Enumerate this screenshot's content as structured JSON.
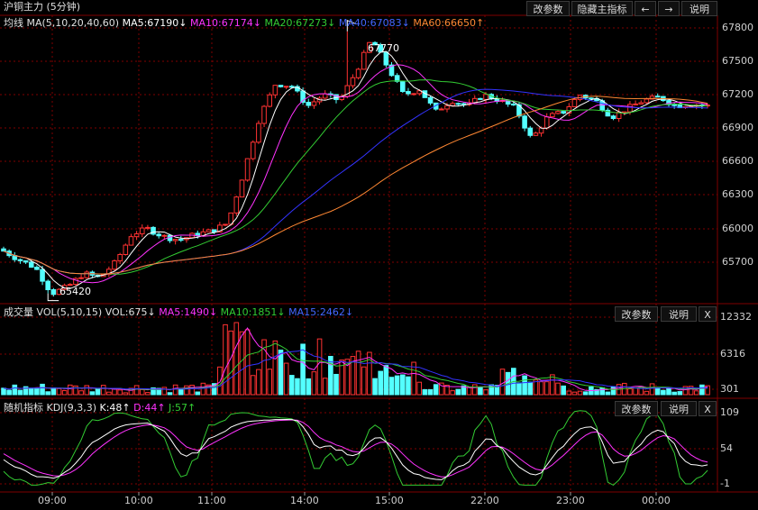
{
  "main_panel": {
    "title": "沪铜主力 (5分钟)",
    "indicator_prefix": "均线",
    "ma_header": "MA(5,10,20,40,60)",
    "ma5": "MA5:67190↓",
    "ma10": "MA10:67174↓",
    "ma20": "MA20:67273↓",
    "ma40": "MA40:67083↓",
    "ma60": "MA60:66650↑",
    "high_marker": "67770",
    "low_marker": "65420",
    "buttons": {
      "params": "改参数",
      "hide": "隐藏主指标",
      "left": "←",
      "right": "→",
      "help": "说明"
    },
    "y_ticks": [
      "67800",
      "67500",
      "67200",
      "66900",
      "66600",
      "66300",
      "66000",
      "65700"
    ]
  },
  "volume_panel": {
    "label": "成交量",
    "vol_header": "VOL(5,10,15)",
    "vol": "VOL:675↓",
    "ma5": "MA5:1490↓",
    "ma10": "MA10:1851↓",
    "ma15": "MA15:2462↓",
    "buttons": {
      "params": "改参数",
      "help": "说明",
      "close": "X"
    },
    "y_ticks": [
      "12332",
      "6316",
      "301"
    ]
  },
  "kdj_panel": {
    "label": "随机指标",
    "kdj_header": "KDJ(9,3,3)",
    "k": "K:48↑",
    "d": "D:44↑",
    "j": "J:57↑",
    "buttons": {
      "params": "改参数",
      "help": "说明",
      "close": "X"
    },
    "y_ticks": [
      "109",
      "54",
      "-1"
    ]
  },
  "x_axis": [
    "09:00",
    "10:00",
    "11:00",
    "14:00",
    "15:00",
    "22:00",
    "23:00",
    "00:00"
  ],
  "colors": {
    "up": "#ff3232",
    "down": "#54ffff",
    "ma5": "#ffffff",
    "ma10": "#ff33ff",
    "ma20": "#33cc33",
    "ma40": "#3333ff",
    "ma60": "#ff8833",
    "grid": "#800000"
  },
  "chart_data": {
    "type": "candlestick",
    "main_y_range": [
      65400,
      67850
    ],
    "volume_y_range": [
      0,
      12500
    ],
    "kdj_y_range": [
      -5,
      115
    ],
    "close_path": [
      65800,
      65720,
      65650,
      65420,
      65480,
      65600,
      65560,
      65700,
      65950,
      66000,
      65930,
      65900,
      65950,
      65980,
      66050,
      66500,
      67000,
      67300,
      67280,
      67100,
      67200,
      67150,
      67400,
      67700,
      67450,
      67200,
      67250,
      67050,
      67150,
      67100,
      67200,
      67150,
      67080,
      66800,
      67000,
      67050,
      67200,
      67150,
      67000,
      67080,
      67150,
      67180,
      67100,
      67120,
      67100
    ]
  }
}
